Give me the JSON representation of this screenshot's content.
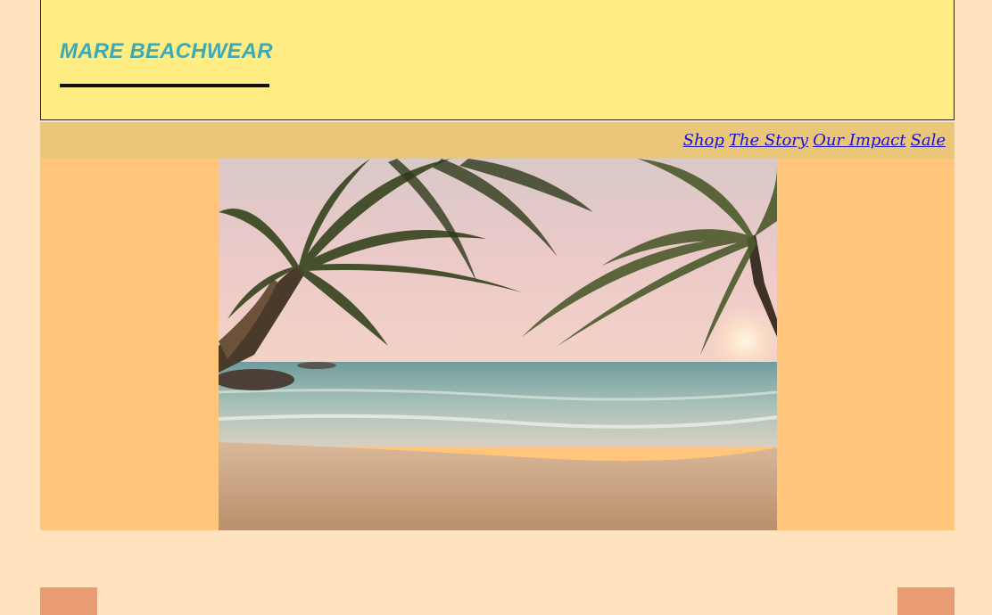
{
  "header": {
    "brand": "MARE BEACHWEAR"
  },
  "nav": {
    "items": [
      {
        "label": "Shop"
      },
      {
        "label": "The Story"
      },
      {
        "label": "Our Impact"
      },
      {
        "label": "Sale"
      }
    ]
  },
  "hero": {
    "image_subject": "palm-trees-beach-sunset"
  },
  "carousel": {
    "prev_icon": "prev-arrow",
    "next_icon": "next-arrow"
  },
  "colors": {
    "page_bg": "#FFE2BE",
    "header_bg": "#FFED84",
    "brand_text": "#3FA9B3",
    "nav_bg": "#EAC778",
    "nav_link": "#1A10D6",
    "hero_bg": "#FFC57A",
    "carousel_button": "#E99C73"
  }
}
